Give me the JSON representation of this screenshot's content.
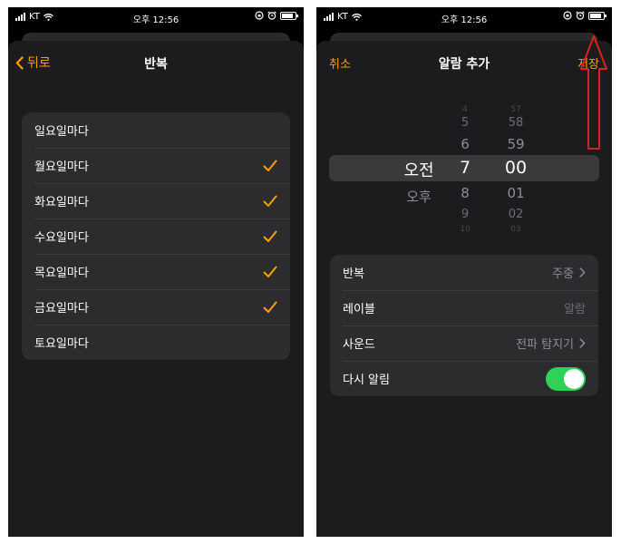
{
  "status_bar": {
    "carrier": "KT",
    "time": "오후 12:56"
  },
  "left_screen": {
    "back_label": "뒤로",
    "title": "반복",
    "days": [
      {
        "label": "일요일마다",
        "checked": false
      },
      {
        "label": "월요일마다",
        "checked": true
      },
      {
        "label": "화요일마다",
        "checked": true
      },
      {
        "label": "수요일마다",
        "checked": true
      },
      {
        "label": "목요일마다",
        "checked": true
      },
      {
        "label": "금요일마다",
        "checked": true
      },
      {
        "label": "토요일마다",
        "checked": false
      }
    ]
  },
  "right_screen": {
    "cancel_label": "취소",
    "title": "알람 추가",
    "save_label": "저장",
    "picker": {
      "ampm": [
        "오전",
        "오후"
      ],
      "selected_ampm": "오전",
      "hours": [
        "4",
        "5",
        "6",
        "7",
        "8",
        "9",
        "10"
      ],
      "selected_hour": "7",
      "minutes": [
        "57",
        "58",
        "59",
        "00",
        "01",
        "02",
        "03"
      ],
      "selected_minute": "00"
    },
    "settings": {
      "repeat": {
        "label": "반복",
        "value": "주중"
      },
      "label": {
        "label": "레이블",
        "value": "알람"
      },
      "sound": {
        "label": "사운드",
        "value": "전파 탐지기"
      },
      "snooze": {
        "label": "다시 알림",
        "on": true
      }
    }
  },
  "colors": {
    "accent": "#ff9f0a",
    "toggle_on": "#30d158",
    "annotation_arrow": "#e02020"
  }
}
